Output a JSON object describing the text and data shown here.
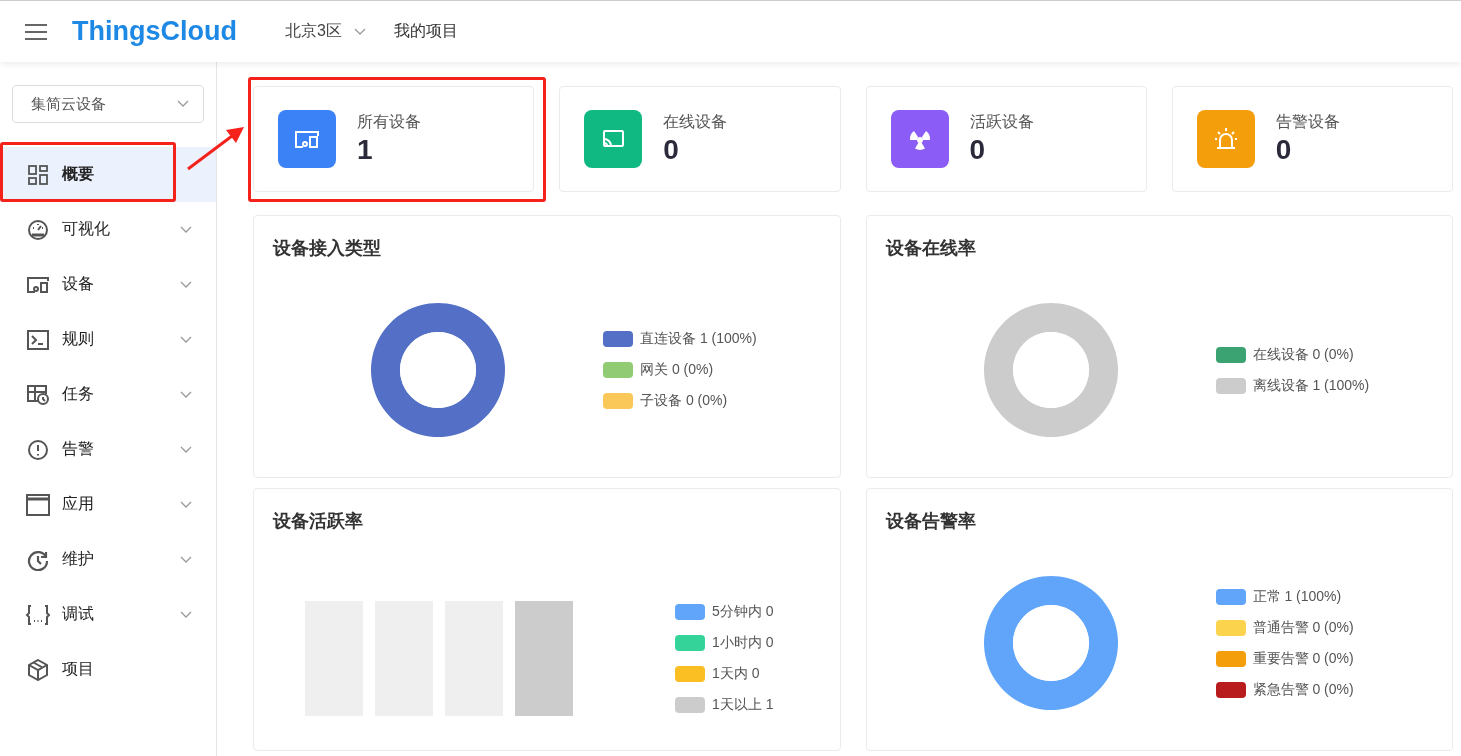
{
  "topbar": {
    "brand": "ThingsCloud",
    "region": "北京3区",
    "project": "我的项目"
  },
  "sidebar": {
    "selector": "集简云设备",
    "items": [
      {
        "label": "概要",
        "selected": true,
        "expandable": false,
        "highlighted": true
      },
      {
        "label": "可视化",
        "selected": false,
        "expandable": true,
        "highlighted": false
      },
      {
        "label": "设备",
        "selected": false,
        "expandable": true,
        "highlighted": false
      },
      {
        "label": "规则",
        "selected": false,
        "expandable": true,
        "highlighted": false
      },
      {
        "label": "任务",
        "selected": false,
        "expandable": true,
        "highlighted": false
      },
      {
        "label": "告警",
        "selected": false,
        "expandable": true,
        "highlighted": false
      },
      {
        "label": "应用",
        "selected": false,
        "expandable": true,
        "highlighted": false
      },
      {
        "label": "维护",
        "selected": false,
        "expandable": true,
        "highlighted": false
      },
      {
        "label": "调试",
        "selected": false,
        "expandable": true,
        "highlighted": false
      },
      {
        "label": "项目",
        "selected": false,
        "expandable": false,
        "highlighted": false
      }
    ]
  },
  "stats": [
    {
      "label": "所有设备",
      "value": "1",
      "color": "#3b82f6",
      "highlighted": true
    },
    {
      "label": "在线设备",
      "value": "0",
      "color": "#10b981",
      "highlighted": false
    },
    {
      "label": "活跃设备",
      "value": "0",
      "color": "#8b5cf6",
      "highlighted": false
    },
    {
      "label": "告警设备",
      "value": "0",
      "color": "#f59e0b",
      "highlighted": false
    }
  ],
  "charts": [
    {
      "title": "设备接入类型",
      "kind": "donut",
      "legend": [
        {
          "label": "1 (100%)",
          "color": "#5470c6"
        },
        {
          "label": "0 (0%)",
          "color": "#91cc75"
        },
        {
          "label": "0 (0%)",
          "color": "#fac858"
        }
      ],
      "chart_data": {
        "type": "donut",
        "categories": [
          "直连设备",
          "网关",
          "子设备"
        ],
        "values": [
          1,
          0,
          0
        ]
      }
    },
    {
      "title": "设备在线率",
      "kind": "donut",
      "legend": [
        {
          "label": "0 (0%)",
          "color": "#3ba272"
        },
        {
          "label": "1 (100%)",
          "color": "#cccccc"
        }
      ],
      "chart_data": {
        "type": "donut",
        "categories": [
          "在线设备",
          "离线设备"
        ],
        "values": [
          0,
          1
        ]
      }
    },
    {
      "title": "设备活跃率",
      "kind": "bars",
      "legend": [
        {
          "label": "5分钟内 0",
          "color": "#60a5fa"
        },
        {
          "label": "1小时内 0",
          "color": "#34d399"
        },
        {
          "label": "1天内 0",
          "color": "#fbbf24"
        },
        {
          "label": "1天以上 1",
          "color": "#cccccc"
        }
      ]
    },
    {
      "title": "设备告警率",
      "kind": "donut",
      "legend": [
        {
          "label": "1 (100%)",
          "color": "#60a5fa"
        },
        {
          "label": "0 (0%)",
          "color": "#fcd34d"
        },
        {
          "label": "0 (0%)",
          "color": "#f59e0b"
        },
        {
          "label": "0 (0%)",
          "color": "#b91c1c"
        }
      ],
      "chart_data": {
        "type": "donut",
        "categories": [
          "正常",
          "普通告警",
          "重要告警",
          "紧急告警"
        ],
        "values": [
          1,
          0,
          0,
          0
        ]
      }
    }
  ]
}
